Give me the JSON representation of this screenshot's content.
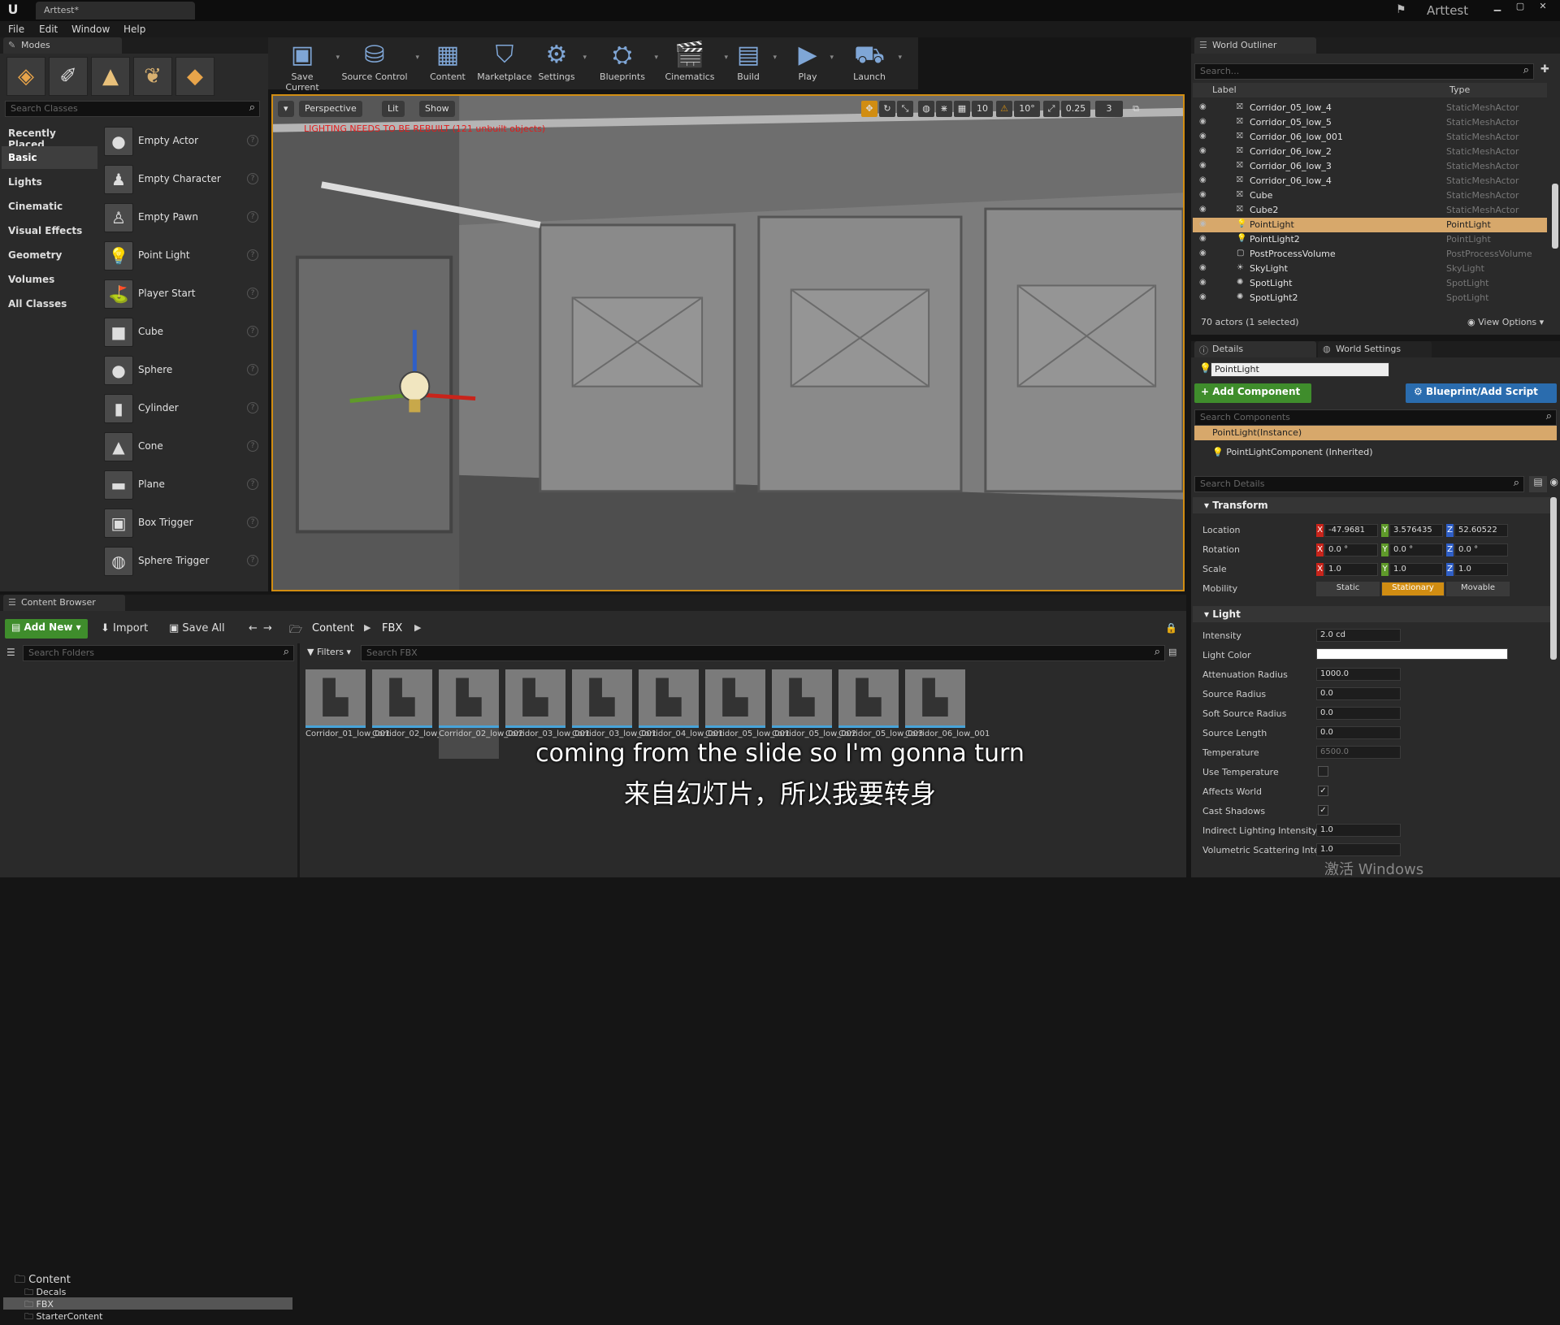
{
  "titlebar": {
    "logo": "U",
    "doc_tab": "Arttest*",
    "app_name": "Arttest",
    "min": "▁",
    "max": "▢",
    "close": "✕"
  },
  "menu": [
    "File",
    "Edit",
    "Window",
    "Help"
  ],
  "modes": {
    "tab": "Modes",
    "search_placeholder": "Search Classes",
    "categories": [
      "Recently Placed",
      "Basic",
      "Lights",
      "Cinematic",
      "Visual Effects",
      "Geometry",
      "Volumes",
      "All Classes"
    ],
    "selected_category": "Basic",
    "items": [
      "Empty Actor",
      "Empty Character",
      "Empty Pawn",
      "Point Light",
      "Player Start",
      "Cube",
      "Sphere",
      "Cylinder",
      "Cone",
      "Plane",
      "Box Trigger",
      "Sphere Trigger"
    ]
  },
  "toolbar": [
    {
      "label": "Save Current",
      "icon": "save-icon",
      "glyph": "▣"
    },
    {
      "label": "Source Control",
      "icon": "source-control-icon",
      "glyph": "⛁"
    },
    {
      "label": "Content",
      "icon": "content-icon",
      "glyph": "▦"
    },
    {
      "label": "Marketplace",
      "icon": "marketplace-icon",
      "glyph": "⛉"
    },
    {
      "label": "Settings",
      "icon": "settings-icon",
      "glyph": "⚙"
    },
    {
      "label": "Blueprints",
      "icon": "blueprints-icon",
      "glyph": "⛭"
    },
    {
      "label": "Cinematics",
      "icon": "cinematics-icon",
      "glyph": "🎬"
    },
    {
      "label": "Build",
      "icon": "build-icon",
      "glyph": "▤"
    },
    {
      "label": "Play",
      "icon": "play-icon",
      "glyph": "▶"
    },
    {
      "label": "Launch",
      "icon": "launch-icon",
      "glyph": "⛟"
    }
  ],
  "viewport": {
    "perspective": "Perspective",
    "lit": "Lit",
    "show": "Show",
    "warning": "LIGHTING NEEDS TO BE REBUILT (121 unbuilt objects)",
    "grid_snap": "10",
    "rot_snap": "10°",
    "scale_snap": "0.25",
    "cam_speed": "3"
  },
  "outliner": {
    "tab": "World Outliner",
    "search_placeholder": "Search...",
    "col_label": "Label",
    "col_type": "Type",
    "rows": [
      {
        "name": "Corridor_05_low_4",
        "type": "StaticMeshActor"
      },
      {
        "name": "Corridor_05_low_5",
        "type": "StaticMeshActor"
      },
      {
        "name": "Corridor_06_low_001",
        "type": "StaticMeshActor"
      },
      {
        "name": "Corridor_06_low_2",
        "type": "StaticMeshActor"
      },
      {
        "name": "Corridor_06_low_3",
        "type": "StaticMeshActor"
      },
      {
        "name": "Corridor_06_low_4",
        "type": "StaticMeshActor"
      },
      {
        "name": "Cube",
        "type": "StaticMeshActor"
      },
      {
        "name": "Cube2",
        "type": "StaticMeshActor"
      },
      {
        "name": "PointLight",
        "type": "PointLight",
        "selected": true
      },
      {
        "name": "PointLight2",
        "type": "PointLight"
      },
      {
        "name": "PostProcessVolume",
        "type": "PostProcessVolume"
      },
      {
        "name": "SkyLight",
        "type": "SkyLight"
      },
      {
        "name": "SpotLight",
        "type": "SpotLight"
      },
      {
        "name": "SpotLight2",
        "type": "SpotLight"
      }
    ],
    "status": "70 actors (1 selected)",
    "view_options": "View Options"
  },
  "details": {
    "tab_details": "Details",
    "tab_world": "World Settings",
    "actor_name": "PointLight",
    "add_component": "+ Add Component",
    "blueprint_script": "Blueprint/Add Script",
    "search_components": "Search Components",
    "component_instance": "PointLight(Instance)",
    "component_child": "PointLightComponent (Inherited)",
    "search_details": "Search Details",
    "transform": {
      "title": "Transform",
      "location_label": "Location",
      "rotation_label": "Rotation",
      "scale_label": "Scale",
      "mobility_label": "Mobility",
      "location": [
        "-47.9681",
        "3.576435",
        "52.60522"
      ],
      "rotation": [
        "0.0 °",
        "0.0 °",
        "0.0 °"
      ],
      "scale": [
        "1.0",
        "1.0",
        "1.0"
      ],
      "mobility": [
        "Static",
        "Stationary",
        "Movable"
      ],
      "mobility_selected": "Stationary"
    },
    "light": {
      "title": "Light",
      "props": [
        {
          "label": "Intensity",
          "value": "2.0 cd"
        },
        {
          "label": "Light Color",
          "value": ""
        },
        {
          "label": "Attenuation Radius",
          "value": "1000.0"
        },
        {
          "label": "Source Radius",
          "value": "0.0"
        },
        {
          "label": "Soft Source Radius",
          "value": "0.0"
        },
        {
          "label": "Source Length",
          "value": "0.0"
        },
        {
          "label": "Temperature",
          "value": "6500.0"
        },
        {
          "label": "Use Temperature",
          "check": false
        },
        {
          "label": "Affects World",
          "check": true
        },
        {
          "label": "Cast Shadows",
          "check": true
        },
        {
          "label": "Indirect Lighting Intensity",
          "value": "1.0"
        },
        {
          "label": "Volumetric Scattering Inter",
          "value": "1.0"
        }
      ]
    }
  },
  "content_browser": {
    "tab": "Content Browser",
    "add_new": "Add New",
    "import": "Import",
    "save_all": "Save All",
    "path": [
      "Content",
      "FBX"
    ],
    "search_folders": "Search Folders",
    "filters": "Filters",
    "search_fbx": "Search FBX",
    "tree": [
      "Content",
      "Decals",
      "FBX",
      "StarterContent"
    ],
    "assets": [
      "Corridor_01_low_001",
      "Corridor_02_low_001",
      "Corridor_02_low_002",
      "Corridor_03_low_001",
      "Corridor_03_low_001",
      "Corridor_04_low_001",
      "Corridor_05_low_001",
      "Corridor_05_low_002",
      "Corridor_05_low_003",
      "Corridor_06_low_001"
    ]
  },
  "subtitle": {
    "en": "coming from the slide so I'm gonna turn",
    "zh": "来自幻灯片，所以我要转身"
  },
  "watermark": "激活 Windows",
  "colors": {
    "accent_orange": "#d18d12",
    "selected_row": "#d7a86b",
    "green": "#3f8d2c",
    "blue": "#2a6cae",
    "axis_x": "#c8241b",
    "axis_y": "#5f9a2a",
    "axis_z": "#2f5fc7"
  }
}
